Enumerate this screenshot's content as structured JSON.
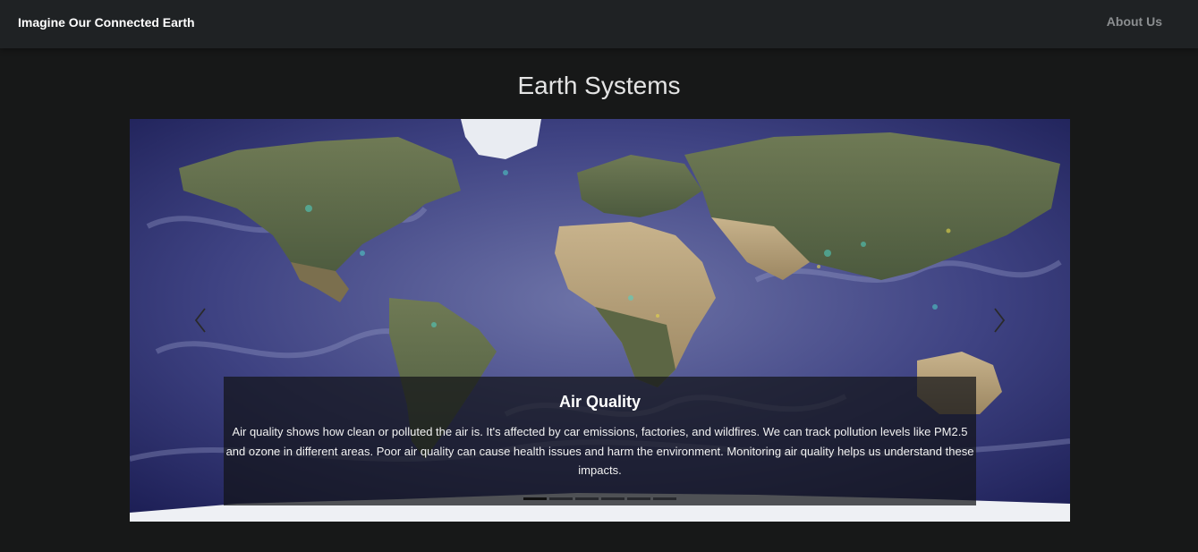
{
  "navbar": {
    "brand": "Imagine Our Connected Earth",
    "about_link": "About Us"
  },
  "page": {
    "title": "Earth Systems"
  },
  "carousel": {
    "slide": {
      "title": "Air Quality",
      "text": "Air quality shows how clean or polluted the air is. It's affected by car emissions, factories, and wildfires. We can track pollution levels like PM2.5 and ozone in different areas. Poor air quality can cause health issues and harm the environment. Monitoring air quality helps us understand these impacts."
    },
    "indicator_count": 6,
    "active_indicator": 1,
    "prev_icon": "chevron-left-icon",
    "next_icon": "chevron-right-icon"
  },
  "colors": {
    "background": "#171818",
    "navbar": "#1f2224",
    "ocean": "#3c3f78",
    "land": "#8a7a58"
  }
}
